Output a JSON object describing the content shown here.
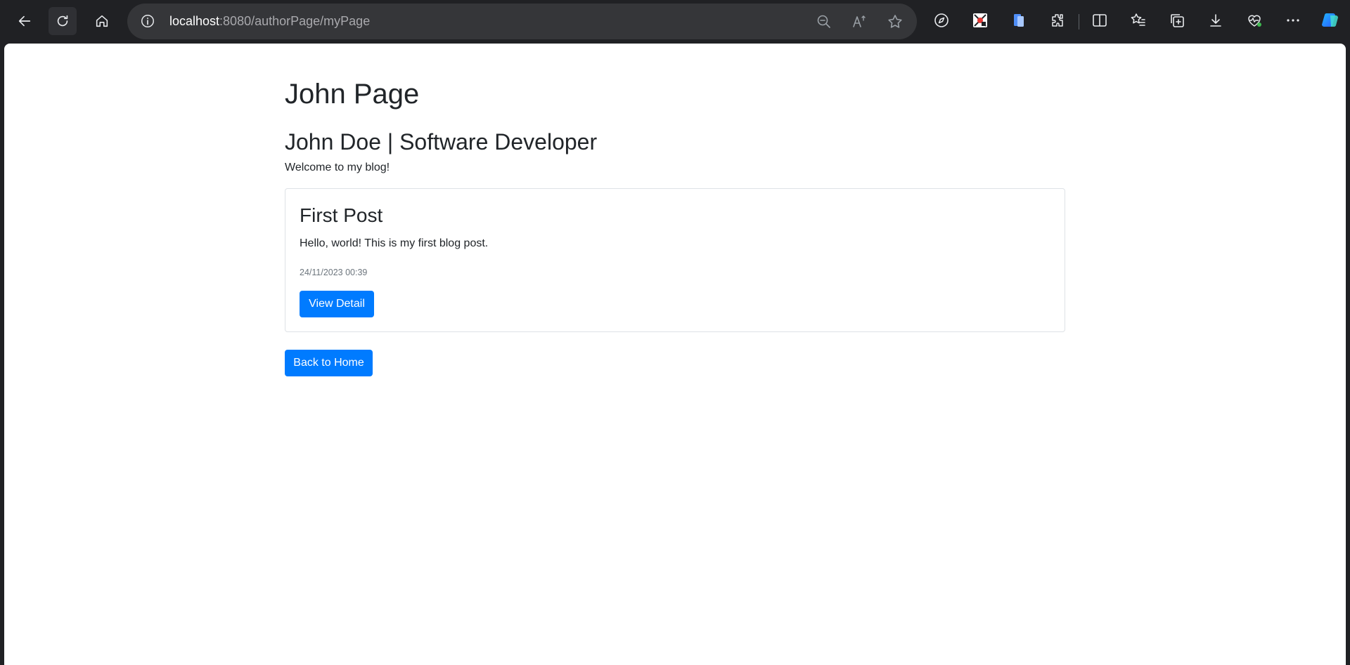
{
  "browser": {
    "url_host": "localhost",
    "url_rest": ":8080/authorPage/myPage",
    "toolbar_icons": [
      "back-icon",
      "refresh-icon",
      "home-icon",
      "info-icon",
      "zoom-out-icon",
      "read-aloud-icon",
      "favorite-star-icon",
      "compass-icon",
      "extension-colorful-icon",
      "extension-blue-icon",
      "puzzle-icon",
      "split-screen-icon",
      "favorites-list-icon",
      "collections-icon",
      "download-icon",
      "health-icon",
      "more-icon",
      "copilot-icon"
    ]
  },
  "page": {
    "title": "John Page",
    "author_heading": "John Doe | Software Developer",
    "welcome": "Welcome to my blog!",
    "posts": [
      {
        "title": "First Post",
        "body": "Hello, world! This is my first blog post.",
        "date": "24/11/2023 00:39",
        "button_label": "View Detail"
      }
    ],
    "back_button_label": "Back to Home"
  },
  "colors": {
    "primary": "#007bff",
    "text": "#212529",
    "muted": "#6c757d",
    "chrome_bg": "#202124"
  }
}
